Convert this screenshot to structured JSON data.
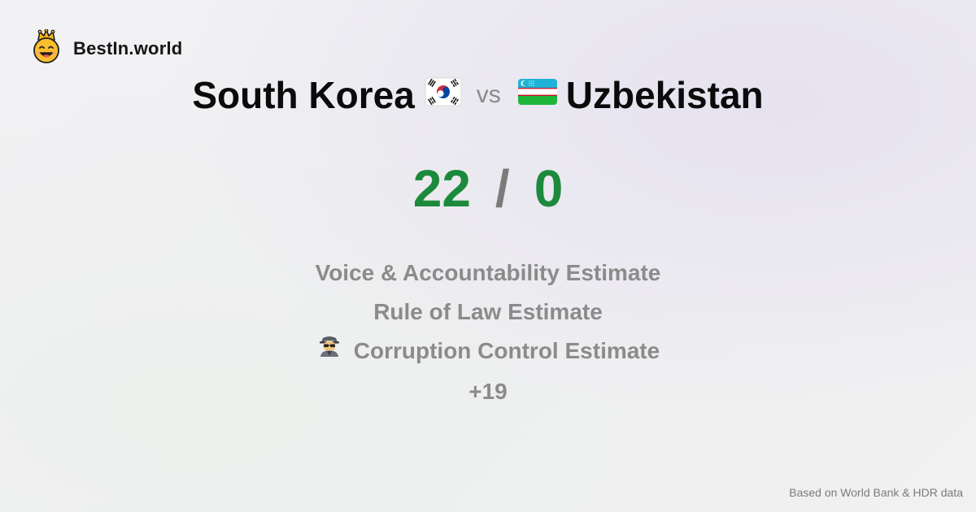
{
  "brand": {
    "name": "BestIn.world",
    "icon": "crowned-smiley-icon"
  },
  "comparison": {
    "left_country": "South Korea",
    "left_flag": "south-korea-flag-icon",
    "vs_label": "vs",
    "right_country": "Uzbekistan",
    "right_flag": "uzbekistan-flag-icon"
  },
  "score": {
    "left": "22",
    "separator": "/",
    "right": "0",
    "color": "#1c8a3d"
  },
  "metrics": [
    {
      "label": "Voice & Accountability Estimate"
    },
    {
      "label": "Rule of Law Estimate"
    },
    {
      "label": "Corruption Control Estimate",
      "icon": "detective-icon"
    },
    {
      "label": "+19"
    }
  ],
  "footer": {
    "source": "Based on World Bank & HDR data"
  }
}
